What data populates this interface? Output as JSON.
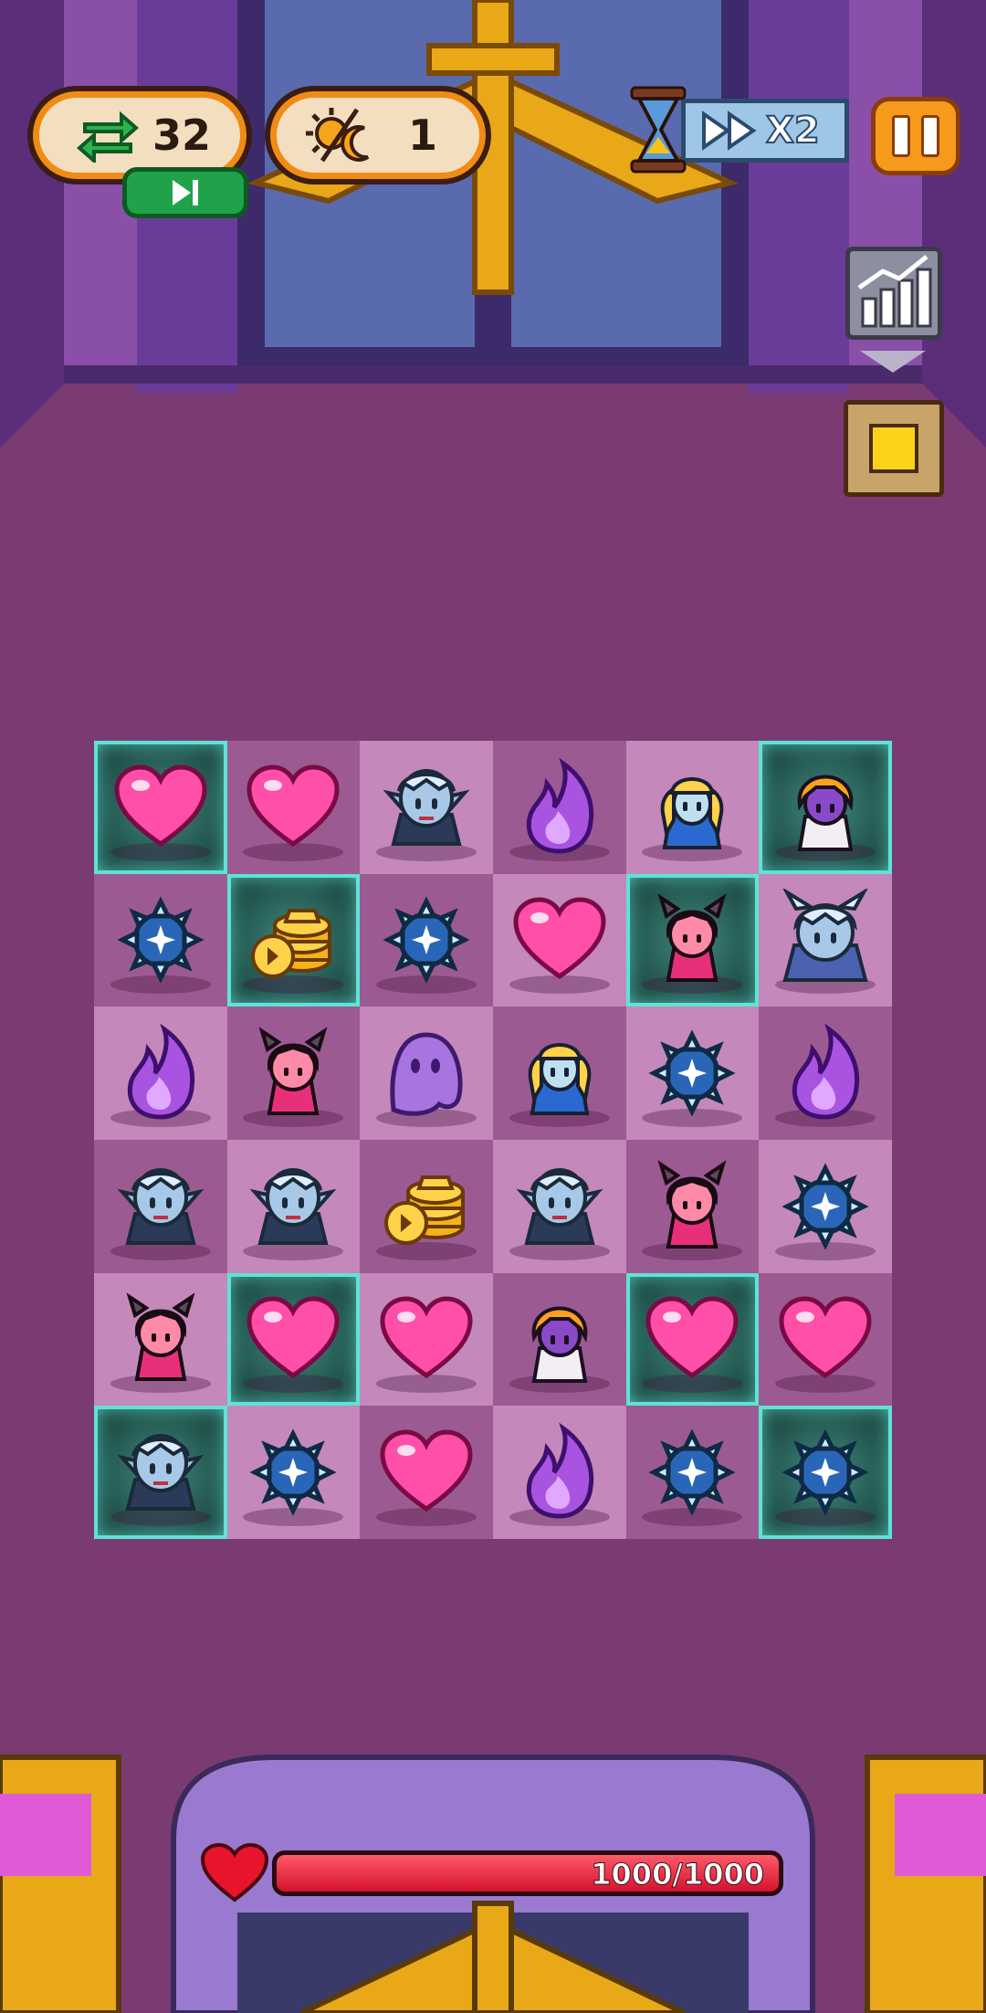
{
  "hud": {
    "moves": "32",
    "gear": "1",
    "speed_label": "X2"
  },
  "health": {
    "text": "1000/1000",
    "fraction": 1.0
  },
  "board": {
    "rows": [
      [
        "heart",
        "heart",
        "elf",
        "flame",
        "blonde",
        "orange-hair"
      ],
      [
        "snowflake",
        "coins",
        "snowflake",
        "heart",
        "demon-girl",
        "horned-elf"
      ],
      [
        "flame",
        "demon-girl",
        "ghost",
        "blonde",
        "snowflake",
        "flame"
      ],
      [
        "elf",
        "elf",
        "coins",
        "elf",
        "demon-girl",
        "snowflake"
      ],
      [
        "demon-girl",
        "heart",
        "heart",
        "orange-hair",
        "heart",
        "heart"
      ],
      [
        "elf",
        "snowflake",
        "heart",
        "flame",
        "snowflake",
        "snowflake"
      ]
    ],
    "glow": [
      [
        true,
        false,
        false,
        false,
        false,
        true
      ],
      [
        false,
        true,
        false,
        false,
        true,
        false
      ],
      [
        false,
        false,
        false,
        false,
        false,
        false
      ],
      [
        false,
        false,
        false,
        false,
        false,
        false
      ],
      [
        false,
        true,
        false,
        false,
        true,
        false
      ],
      [
        true,
        false,
        false,
        false,
        false,
        true
      ]
    ]
  },
  "colors": {
    "accent": "#f08c14",
    "glow": "#5fe3d4",
    "hp": "#d3122c"
  }
}
